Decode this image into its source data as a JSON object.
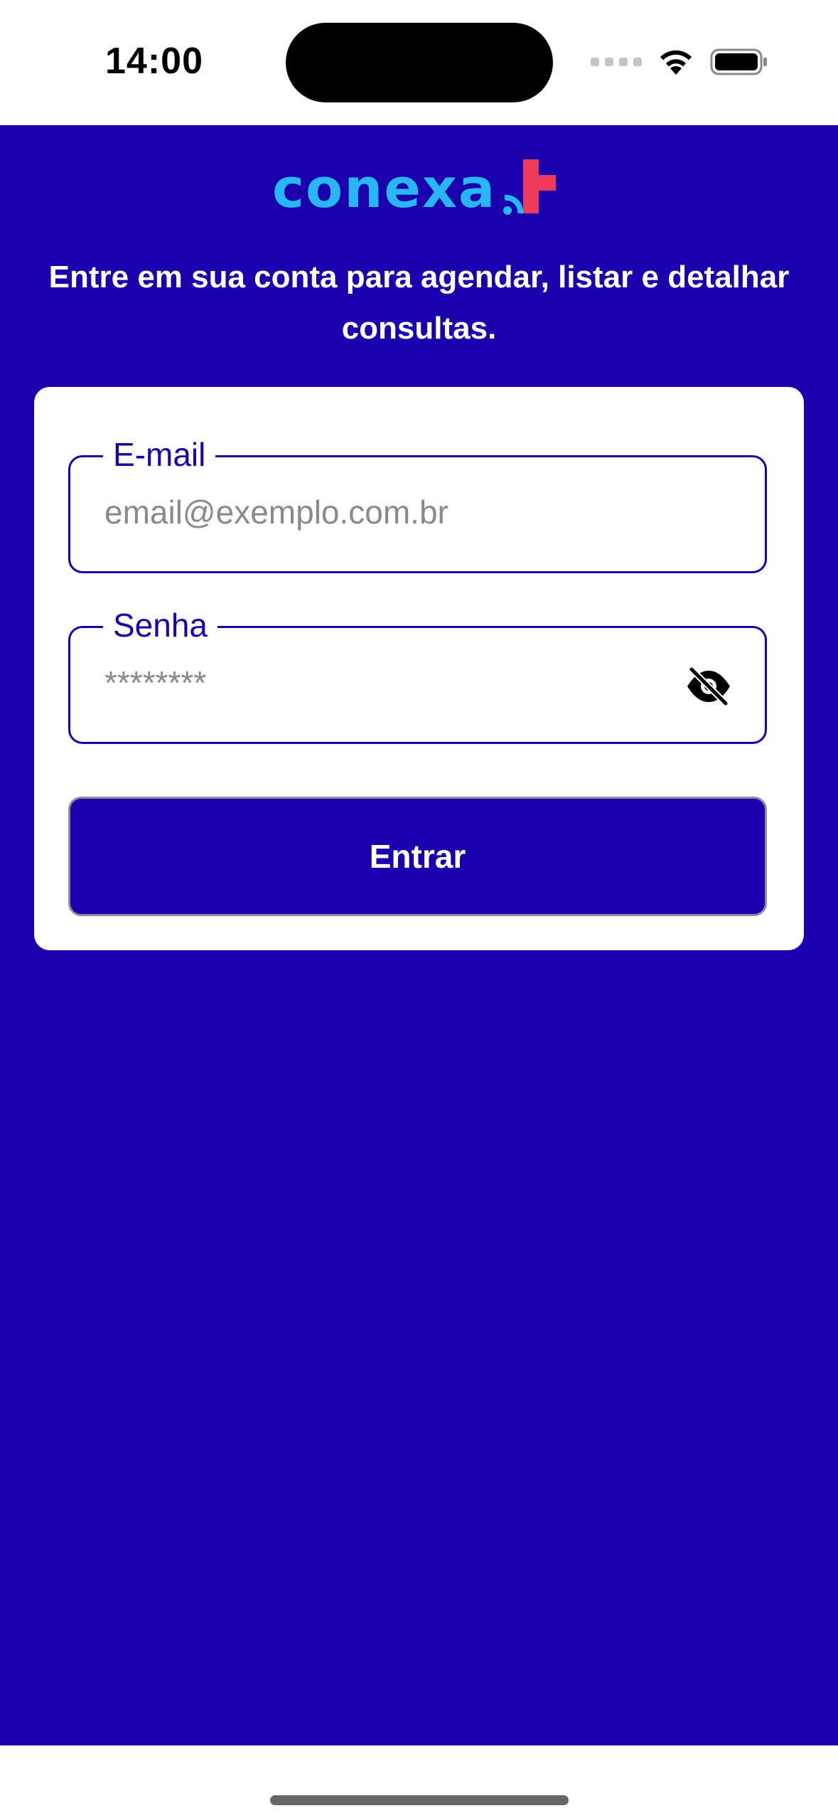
{
  "status_bar": {
    "time": "14:00"
  },
  "brand": {
    "logo_text": "conexa",
    "logo_color": "#29b6f6",
    "mark_color": "#ef3b5b"
  },
  "colors": {
    "primary": "#1a00ad",
    "background": "#1a00ad",
    "card": "#ffffff",
    "placeholder": "#8a8a8a"
  },
  "login": {
    "subtitle": "Entre em sua conta para agendar, listar e detalhar consultas.",
    "email": {
      "label": "E-mail",
      "placeholder": "email@exemplo.com.br",
      "value": ""
    },
    "password": {
      "label": "Senha",
      "placeholder": "********",
      "value": "",
      "toggle_icon": "eye-off-icon"
    },
    "submit_label": "Entrar"
  }
}
